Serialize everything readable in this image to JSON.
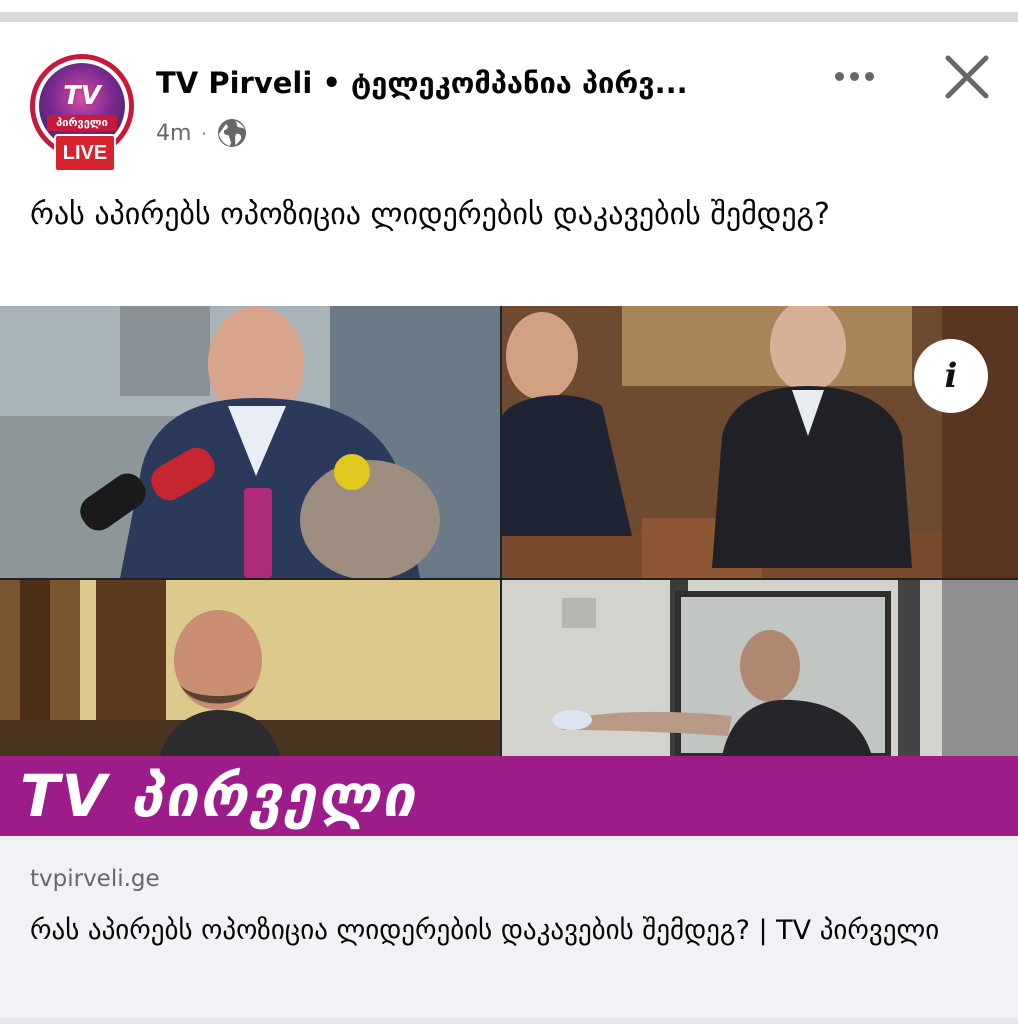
{
  "post": {
    "page_name": "TV Pirveli • ტელეკომპანია პირვ...",
    "time": "4m",
    "separator": "·",
    "privacy_icon": "globe-icon",
    "text": "რას აპირებს ოპოზიცია ლიდერების დაკავების შემდეგ?"
  },
  "avatar": {
    "logo_text": "TV",
    "logo_sub": "პირველი",
    "live_badge": "LIVE"
  },
  "actions": {
    "more_icon": "more-horizontal-icon",
    "close_icon": "close-icon"
  },
  "media": {
    "info_label": "i",
    "brand_text": "TV პირველი"
  },
  "link_preview": {
    "domain": "tvpirveli.ge",
    "title": "რას აპირებს ოპოზიცია ლიდერების დაკავების შემდეგ? | TV პირველი"
  },
  "colors": {
    "brand_magenta": "#9c1c8a",
    "live_red": "#d7232f",
    "secondary_text": "#65676b",
    "link_bg": "#f0f2f5"
  }
}
